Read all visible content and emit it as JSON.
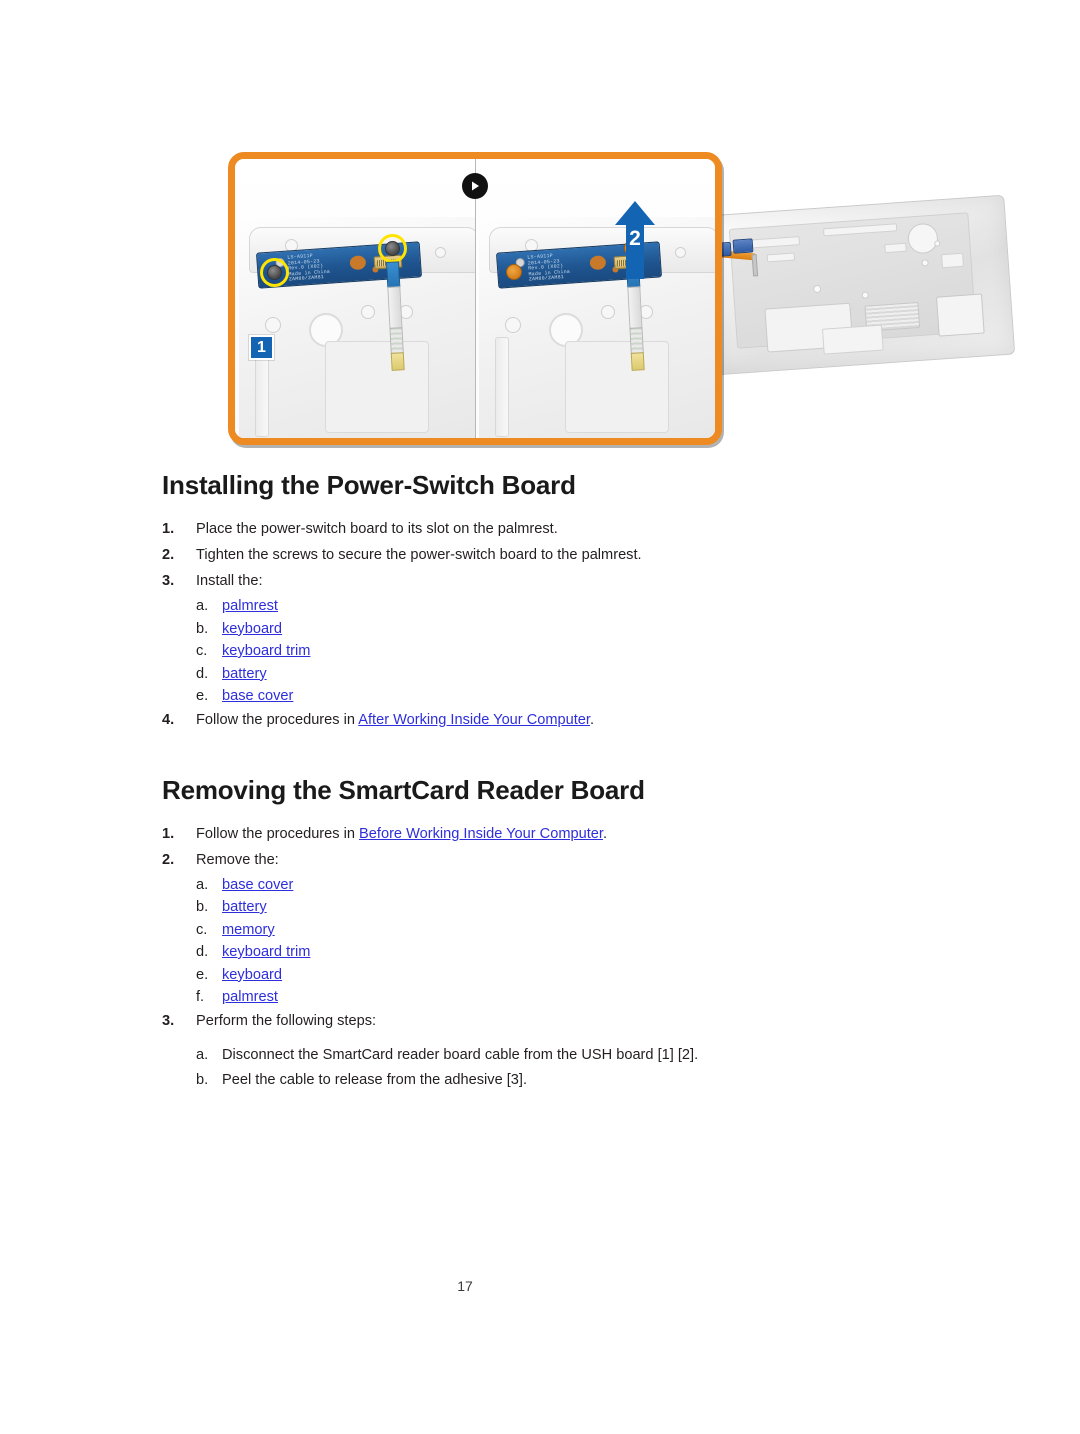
{
  "figure": {
    "name": "power-switch-board-installation-figure",
    "frame_color": "#ED8B22",
    "panels": [
      {
        "name": "before-panel",
        "callouts": [
          {
            "type": "square-badge",
            "label": "1",
            "color": "#1464B4"
          }
        ],
        "pcb_text": "LS-A911P\n2014-05-23\nRev.0 (X02)\nMade in China\nZAM80/ZAM81"
      },
      {
        "name": "after-panel",
        "callouts": [
          {
            "type": "arrow-badge",
            "label": "2",
            "color": "#1464B4"
          }
        ],
        "pcb_text": "LS-A911P\n2014-05-23\nRev.0 (X02)\nMade in China\nZAM80/ZAM81"
      }
    ],
    "divider_icon": "play-icon"
  },
  "sections": [
    {
      "title": "Installing the Power-Switch Board",
      "steps": [
        {
          "marker": "1.",
          "text": "Place the power-switch board to its slot on the palmrest."
        },
        {
          "marker": "2.",
          "text": "Tighten the screws to secure the power-switch board to the palmrest."
        },
        {
          "marker": "3.",
          "text": "Install the:",
          "substeps": [
            {
              "marker": "a.",
              "label": "palmrest",
              "link": true
            },
            {
              "marker": "b.",
              "label": "keyboard",
              "link": true
            },
            {
              "marker": "c.",
              "label": "keyboard trim",
              "link": true
            },
            {
              "marker": "d.",
              "label": "battery",
              "link": true
            },
            {
              "marker": "e.",
              "label": "base cover",
              "link": true
            }
          ]
        },
        {
          "marker": "4.",
          "prefix": "Follow the procedures in ",
          "link_text": "After Working Inside Your Computer",
          "suffix": "."
        }
      ]
    },
    {
      "title": "Removing the SmartCard Reader Board",
      "steps": [
        {
          "marker": "1.",
          "prefix": "Follow the procedures in ",
          "link_text": "Before Working Inside Your Computer",
          "suffix": "."
        },
        {
          "marker": "2.",
          "text": "Remove the:",
          "substeps": [
            {
              "marker": "a.",
              "label": "base cover",
              "link": true
            },
            {
              "marker": "b.",
              "label": "battery",
              "link": true
            },
            {
              "marker": "c.",
              "label": "memory",
              "link": true
            },
            {
              "marker": "d.",
              "label": "keyboard trim",
              "link": true
            },
            {
              "marker": "e.",
              "label": "keyboard",
              "link": true
            },
            {
              "marker": "f.",
              "label": "palmrest",
              "link": true
            }
          ]
        },
        {
          "marker": "3.",
          "text": "Perform the following steps:",
          "substeps": [
            {
              "marker": "a.",
              "label": "Disconnect the SmartCard reader board cable from the USH board [1] [2].",
              "link": false
            },
            {
              "marker": "b.",
              "label": "Peel the cable to release from the adhesive [3].",
              "link": false
            }
          ]
        }
      ]
    }
  ],
  "footer": {
    "page_number": "17"
  }
}
